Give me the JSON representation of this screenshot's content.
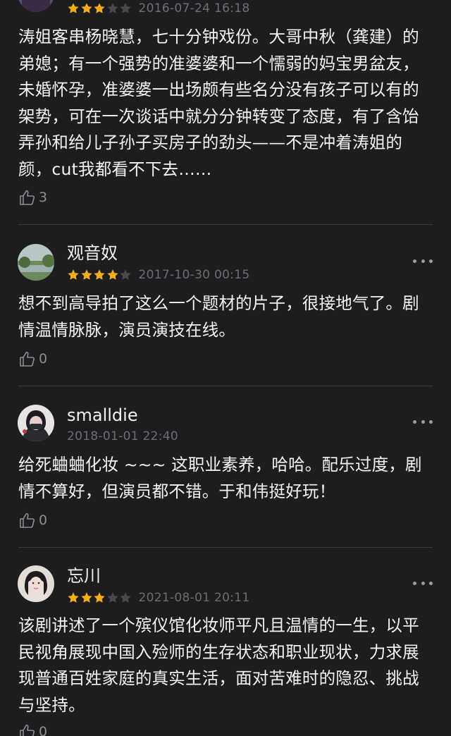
{
  "colors": {
    "background": "#1d1d1f",
    "star_filled": "#f2ad1a",
    "star_empty": "#4a4a4e",
    "meta_text": "#6e6e72",
    "divider": "#38383c"
  },
  "reviews": [
    {
      "user": "",
      "rating": 3,
      "max_rating": 5,
      "date": "2016-07-24 16:18",
      "text": "涛姐客串杨晓慧，七十分钟戏份。大哥中秋（龚建）的弟媳；有一个强势的准婆婆和一个懦弱的妈宝男盆友，未婚怀孕，准婆婆一出场颇有些名分没有孩子可以有的架势，可在一次谈话中就分分钟转变了态度，有了含饴弄孙和给儿子孙子买房子的劲头——不是冲着涛姐的颜，cut我都看不下去……",
      "likes": "3",
      "like_icon": "thumbs-up-icon",
      "more_icon": "more-dots-icon"
    },
    {
      "user": "观音奴",
      "rating": 4,
      "max_rating": 5,
      "date": "2017-10-30 00:15",
      "text": "想不到高导拍了这么一个题材的片子，很接地气了。剧情温情脉脉，演员演技在线。",
      "likes": "0",
      "like_icon": "thumbs-up-icon",
      "more_icon": "more-dots-icon"
    },
    {
      "user": "smalldie",
      "rating": 0,
      "max_rating": 0,
      "date": "2018-01-01 22:40",
      "text": "给死蛐蛐化妆 ~~~ 这职业素养，哈哈。配乐过度，剧情不算好，但演员都不错。于和伟挺好玩！",
      "likes": "0",
      "like_icon": "thumbs-up-icon",
      "more_icon": "more-dots-icon"
    },
    {
      "user": "忘川",
      "rating": 3,
      "max_rating": 5,
      "date": "2021-08-01 20:11",
      "text": "该剧讲述了一个殡仪馆化妆师平凡且温情的一生，以平民视角展现中国入殓师的生存状态和职业现状，力求展现普通百姓家庭的真实生活，面对苦难时的隐忍、挑战与坚持。",
      "likes": "0",
      "like_icon": "thumbs-up-icon",
      "more_icon": "more-dots-icon"
    }
  ]
}
